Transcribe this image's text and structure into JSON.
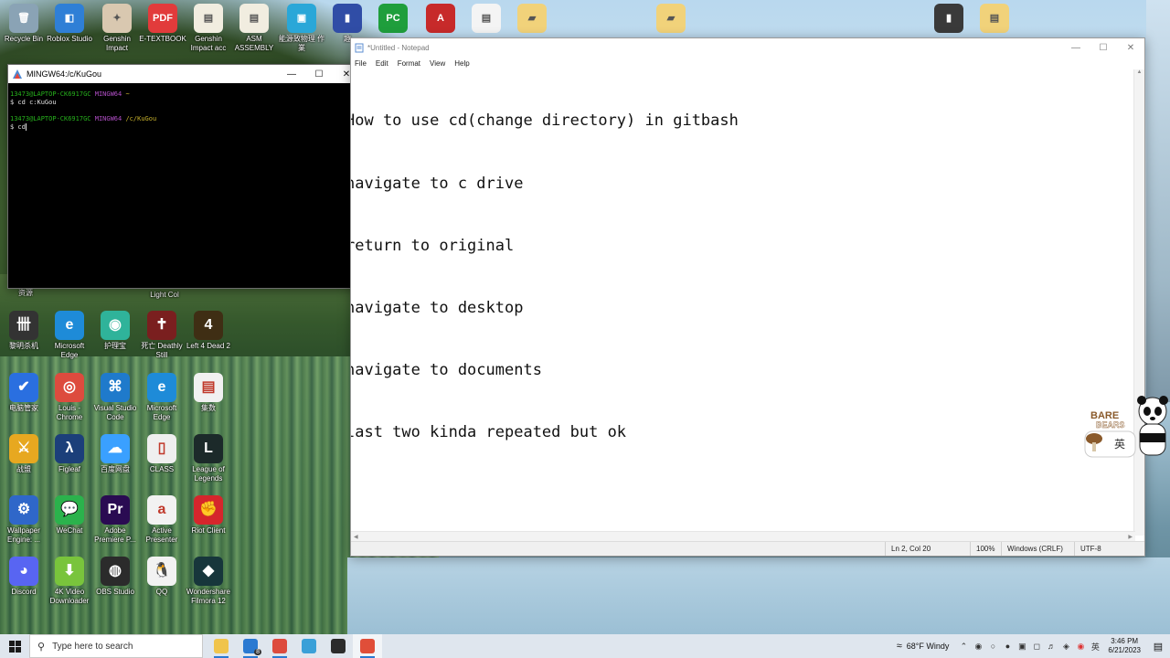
{
  "desktop": {
    "top_row": [
      {
        "label": "Recycle Bin",
        "color": "#8aa3b5",
        "glyph": "🗑"
      },
      {
        "label": "Roblox Studio",
        "color": "#2f7fd6",
        "glyph": "◧"
      },
      {
        "label": "Genshin Impact",
        "color": "#d9c8b0",
        "glyph": "✦"
      },
      {
        "label": "E-TEXTBOOK",
        "color": "#e23b3b",
        "glyph": "PDF"
      },
      {
        "label": "Genshin Impact acc",
        "color": "#f1ede0",
        "glyph": "▤"
      },
      {
        "label": "ASM ASSEMBLY",
        "color": "#f1ede0",
        "glyph": "▤"
      },
      {
        "label": "能源致物理 作業",
        "color": "#2aa7d8",
        "glyph": "▣"
      },
      {
        "label": "趣",
        "color": "#304da6",
        "glyph": "▮"
      },
      {
        "label": "",
        "color": "#1f9e3c",
        "glyph": "PC"
      },
      {
        "label": "",
        "color": "#c72a2a",
        "glyph": "A"
      },
      {
        "label": "",
        "color": "#f4f4f4",
        "glyph": "▤"
      },
      {
        "label": "",
        "color": "#f1d27a",
        "glyph": "▰"
      },
      {
        "label": "",
        "color": "#f1d27a",
        "glyph": "▰"
      },
      {
        "label": "",
        "color": "#3a3a3a",
        "glyph": "▮"
      },
      {
        "label": "",
        "color": "#f1d27a",
        "glyph": "▤"
      }
    ],
    "partial_labels": {
      "left": "资源",
      "center": "Light Col"
    },
    "grid": [
      [
        {
          "label": "黎明杀机",
          "color": "#333333",
          "glyph": "卌"
        },
        {
          "label": "Microsoft Edge",
          "color": "#1e8bd8",
          "glyph": "e"
        },
        {
          "label": "护理宝",
          "color": "#2fb39a",
          "glyph": "◉"
        },
        {
          "label": "死亡 Deathly Still",
          "color": "#7a1f1f",
          "glyph": "✝"
        },
        {
          "label": "Left 4 Dead 2",
          "color": "#3f2e14",
          "glyph": "4"
        }
      ],
      [
        {
          "label": "电脑管家",
          "color": "#2a6fe0",
          "glyph": "✔"
        },
        {
          "label": "Louis - Chrome",
          "color": "#dd4b3e",
          "glyph": "◎"
        },
        {
          "label": "Visual Studio Code",
          "color": "#1f7acb",
          "glyph": "⌘"
        },
        {
          "label": "Microsoft Edge",
          "color": "#1e8bd8",
          "glyph": "e"
        },
        {
          "label": "集数",
          "color": "#f1f1f1",
          "glyph": "▤"
        }
      ],
      [
        {
          "label": "战盟",
          "color": "#e7a820",
          "glyph": "⚔"
        },
        {
          "label": "Figleaf",
          "color": "#1c3f7a",
          "glyph": "λ"
        },
        {
          "label": "百度网盘",
          "color": "#3aa0ff",
          "glyph": "☁"
        },
        {
          "label": "CLASS",
          "color": "#efefef",
          "glyph": "▯"
        },
        {
          "label": "League of Legends",
          "color": "#1c2a2a",
          "glyph": "L"
        }
      ],
      [
        {
          "label": "Wallpaper Engine: ...",
          "color": "#2f67c9",
          "glyph": "⚙"
        },
        {
          "label": "WeChat",
          "color": "#2bb24c",
          "glyph": "💬"
        },
        {
          "label": "Adobe Premiere P...",
          "color": "#2a0b52",
          "glyph": "Pr"
        },
        {
          "label": "Active Presenter",
          "color": "#f2f2f2",
          "glyph": "a"
        },
        {
          "label": "Riot Client",
          "color": "#d5262c",
          "glyph": "✊"
        }
      ],
      [
        {
          "label": "Discord",
          "color": "#5865f2",
          "glyph": "◕"
        },
        {
          "label": "4K Video Downloader",
          "color": "#79c43c",
          "glyph": "⬇"
        },
        {
          "label": "OBS Studio",
          "color": "#2b2b2b",
          "glyph": "◍"
        },
        {
          "label": "QQ",
          "color": "#f2f2f2",
          "glyph": "🐧"
        },
        {
          "label": "Wondershare Filmora 12",
          "color": "#17363b",
          "glyph": "◆"
        }
      ]
    ]
  },
  "terminal": {
    "title": "MINGW64:/c/KuGou",
    "lines": [
      {
        "user": "13473@LAPTOP-CK6917GC",
        "env": "MINGW64",
        "path": "~"
      },
      {
        "cmd": "$ cd c:KuGou"
      },
      {
        "user": "13473@LAPTOP-CK6917GC",
        "env": "MINGW64",
        "path": "/c/KuGou"
      },
      {
        "cmd": "$ cd"
      }
    ]
  },
  "notepad": {
    "title": "*Untitled - Notepad",
    "menu": [
      "File",
      "Edit",
      "Format",
      "View",
      "Help"
    ],
    "lines": [
      "How to use cd(change directory) in gitbash",
      "navigate to c drive",
      "return to original",
      "navigate to desktop",
      "navigate to documents",
      "last two kinda repeated but ok"
    ],
    "status": {
      "position": "Ln 2, Col 20",
      "zoom": "100%",
      "line_ending": "Windows (CRLF)",
      "encoding": "UTF-8"
    }
  },
  "sticker": {
    "brand": "We BARE BEARS",
    "char": "英"
  },
  "taskbar": {
    "search_placeholder": "Type here to search",
    "apps": [
      {
        "name": "file-explorer",
        "color": "#f0c44c"
      },
      {
        "name": "mail",
        "color": "#2a79d1",
        "badge": "8"
      },
      {
        "name": "chrome",
        "color": "#dd4b3e"
      },
      {
        "name": "app",
        "color": "#3aa0d8"
      },
      {
        "name": "obs",
        "color": "#2b2b2b"
      },
      {
        "name": "git",
        "color": "#e04e39"
      }
    ],
    "weather": {
      "temp": "68°F",
      "desc": "Windy"
    },
    "time": "3:46 PM",
    "date": "6/21/2023"
  }
}
